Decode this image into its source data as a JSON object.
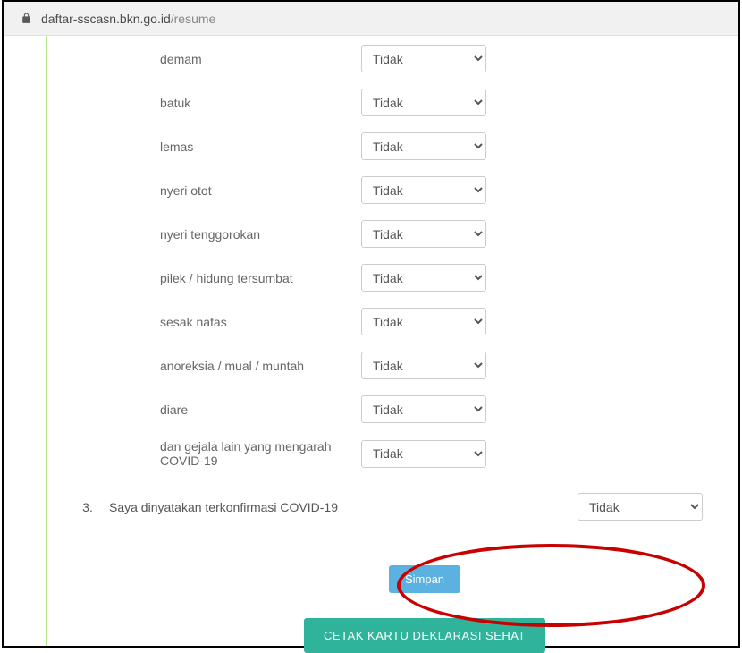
{
  "browser": {
    "url_host": "daftar-sscasn.bkn.go.id",
    "url_path": "/resume"
  },
  "symptoms": [
    {
      "label": "demam",
      "value": "Tidak"
    },
    {
      "label": "batuk",
      "value": "Tidak"
    },
    {
      "label": "lemas",
      "value": "Tidak"
    },
    {
      "label": "nyeri otot",
      "value": "Tidak"
    },
    {
      "label": "nyeri tenggorokan",
      "value": "Tidak"
    },
    {
      "label": "pilek / hidung tersumbat",
      "value": "Tidak"
    },
    {
      "label": "sesak nafas",
      "value": "Tidak"
    },
    {
      "label": "anoreksia / mual / muntah",
      "value": "Tidak"
    },
    {
      "label": "diare",
      "value": "Tidak"
    },
    {
      "label": "dan gejala lain yang mengarah COVID-19",
      "value": "Tidak"
    }
  ],
  "question3": {
    "number": "3.",
    "text": "Saya dinyatakan terkonfirmasi COVID-19",
    "value": "Tidak"
  },
  "buttons": {
    "simpan": "Simpan",
    "cetak": "CETAK KARTU DEKLARASI SEHAT"
  },
  "select_options": {
    "tidak": "Tidak"
  }
}
